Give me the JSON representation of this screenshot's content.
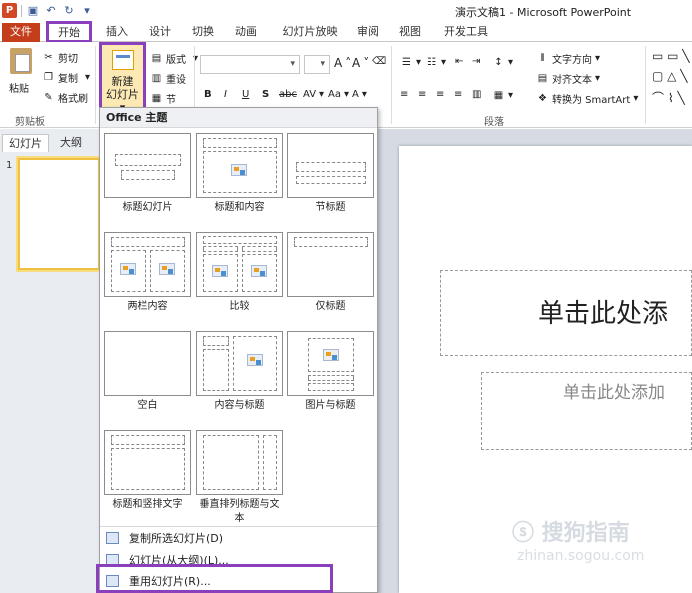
{
  "window": {
    "doc_title": "演示文稿1 - Microsoft PowerPoint",
    "app_icon": "P"
  },
  "tabs": [
    {
      "label": "文件"
    },
    {
      "label": "开始"
    },
    {
      "label": "插入"
    },
    {
      "label": "设计"
    },
    {
      "label": "切换"
    },
    {
      "label": "动画"
    },
    {
      "label": "幻灯片放映"
    },
    {
      "label": "审阅"
    },
    {
      "label": "视图"
    },
    {
      "label": "开发工具"
    }
  ],
  "ribbon": {
    "clipboard": {
      "paste": "粘贴",
      "cut": "剪切",
      "copy": "复制",
      "format_painter": "格式刷",
      "group_label": "剪贴板"
    },
    "slides": {
      "new_slide_line1": "新建",
      "new_slide_line2": "幻灯片",
      "layout": "版式",
      "reset": "重设",
      "section": "节"
    },
    "font": {
      "bold": "B",
      "italic": "I",
      "underline": "U",
      "shadow": "S",
      "strike": "abc",
      "spacing": "AV",
      "case": "Aa",
      "grow": "A",
      "shrink": "A",
      "color": "A"
    },
    "paragraph": {
      "text_direction": "文字方向",
      "align_text": "对齐文本",
      "smartart": "转换为 SmartArt",
      "group_label": "段落"
    }
  },
  "left_pane": {
    "tab_slides": "幻灯片",
    "tab_outline": "大纲",
    "slide_number": "1"
  },
  "slide": {
    "title_placeholder": "单击此处添",
    "subtitle_placeholder": "单击此处添加"
  },
  "watermark": {
    "text": "搜狗指南",
    "url": "zhinan.sogou.com"
  },
  "dropdown": {
    "header": "Office 主题",
    "layouts": [
      {
        "label": "标题幻灯片"
      },
      {
        "label": "标题和内容"
      },
      {
        "label": "节标题"
      },
      {
        "label": "两栏内容"
      },
      {
        "label": "比较"
      },
      {
        "label": "仅标题"
      },
      {
        "label": "空白"
      },
      {
        "label": "内容与标题"
      },
      {
        "label": "图片与标题"
      },
      {
        "label": "标题和竖排文字"
      },
      {
        "label": "垂直排列标题与文本"
      }
    ],
    "commands": [
      {
        "label": "复制所选幻灯片(D)"
      },
      {
        "label": "幻灯片(从大纲)(L)..."
      },
      {
        "label": "重用幻灯片(R)..."
      }
    ]
  },
  "colors": {
    "file_tab": "#c43e1c",
    "highlight": "#8a3fbd",
    "new_slide_bg": "#fce9b4",
    "thumb_border": "#f0c040"
  }
}
